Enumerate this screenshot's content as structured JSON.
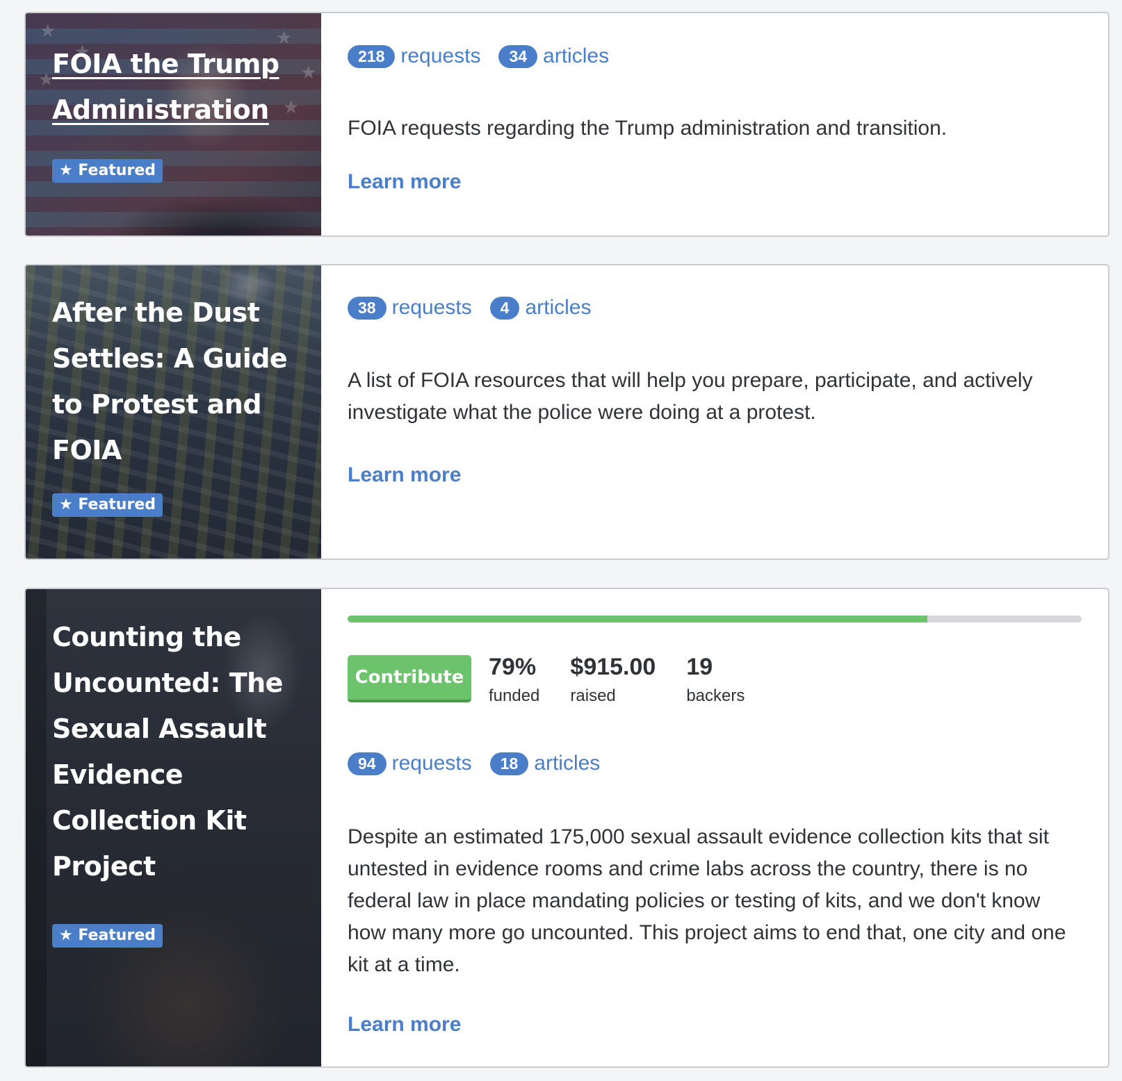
{
  "cards": [
    {
      "title": "FOIA the Trump Administration",
      "featured": "★ Featured",
      "requests_count": "218",
      "requests_label": "requests",
      "articles_count": "34",
      "articles_label": "articles",
      "description": "FOIA requests regarding the Trump administration and transition.",
      "learn_more": "Learn more"
    },
    {
      "title": "After the Dust Settles: A Guide to Protest and FOIA",
      "featured": "★ Featured",
      "requests_count": "38",
      "requests_label": "requests",
      "articles_count": "4",
      "articles_label": "articles",
      "description": "A list of FOIA resources that will help you prepare, participate, and actively investigate what the police were doing at a protest.",
      "learn_more": "Learn more"
    },
    {
      "title": "Counting the Uncounted: The Sexual Assault Evidence Collection Kit Project",
      "featured": "★ Featured",
      "progress_fraction": 0.79,
      "contribute_label": "Contribute",
      "funded_value": "79%",
      "funded_label": "funded",
      "raised_value": "$915.00",
      "raised_label": "raised",
      "backers_value": "19",
      "backers_label": "backers",
      "requests_count": "94",
      "requests_label": "requests",
      "articles_count": "18",
      "articles_label": "articles",
      "description": "Despite an estimated 175,000 sexual assault evidence collection kits that sit untested in evidence rooms and crime labs across the country, there is no federal law in place mandating policies or testing of kits, and we don't know how many more go uncounted. This project aims to end that, one city and one kit at a time.",
      "learn_more": "Learn more"
    }
  ],
  "colors": {
    "link_blue": "#4a7ec9",
    "progress_green": "#6cc36c",
    "progress_track": "#d6d8db"
  }
}
